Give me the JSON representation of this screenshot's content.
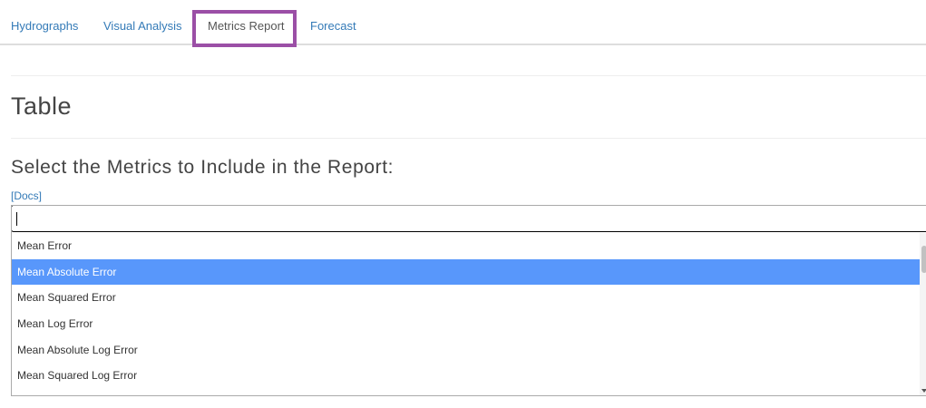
{
  "tabs": [
    {
      "label": "Hydrographs",
      "active": false
    },
    {
      "label": "Visual Analysis",
      "active": false
    },
    {
      "label": "Metrics Report",
      "active": true
    },
    {
      "label": "Forecast",
      "active": false
    }
  ],
  "page": {
    "title": "Table",
    "section_title": "Select the Metrics to Include in the Report:",
    "docs_link": "[Docs]"
  },
  "metrics_select": {
    "search_value": "",
    "options": [
      {
        "label": "Mean Error",
        "highlighted": false
      },
      {
        "label": "Mean Absolute Error",
        "highlighted": true
      },
      {
        "label": "Mean Squared Error",
        "highlighted": false
      },
      {
        "label": "Mean Log Error",
        "highlighted": false
      },
      {
        "label": "Mean Absolute Log Error",
        "highlighted": false
      },
      {
        "label": "Mean Squared Log Error",
        "highlighted": false
      }
    ]
  },
  "colors": {
    "link": "#337ab7",
    "highlight_border": "#9b4fa6",
    "option_highlight": "#5897fb"
  }
}
